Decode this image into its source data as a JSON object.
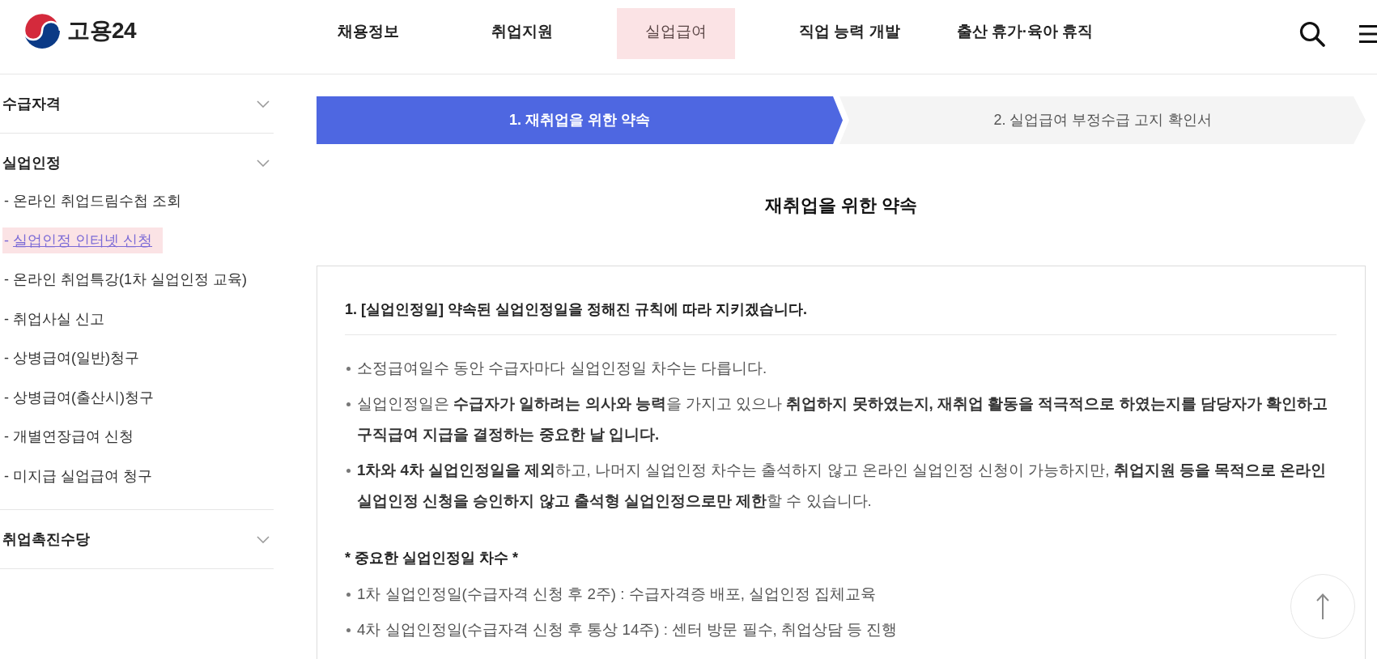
{
  "header": {
    "logo": {
      "text": "고용24"
    },
    "nav": [
      {
        "label": "채용정보",
        "selected": false
      },
      {
        "label": "취업지원",
        "selected": false
      },
      {
        "label": "실업급여",
        "selected": true
      },
      {
        "label": "직업 능력 개발",
        "selected": false
      },
      {
        "label": "출산 휴가·육아 휴직",
        "selected": false
      }
    ]
  },
  "sidebar": {
    "sections": [
      {
        "title": "수급자격"
      },
      {
        "title": "실업인정",
        "items": [
          {
            "bullet": "-",
            "label": "온라인 취업드림수첩 조회",
            "selected": false
          },
          {
            "bullet": "-",
            "label": "실업인정 인터넷 신청",
            "selected": true
          },
          {
            "bullet": "-",
            "label": "온라인 취업특강(1차 실업인정 교육)",
            "selected": false
          },
          {
            "bullet": "-",
            "label": "취업사실 신고",
            "selected": false
          },
          {
            "bullet": "-",
            "label": "상병급여(일반)청구",
            "selected": false
          },
          {
            "bullet": "-",
            "label": "상병급여(출산시)청구",
            "selected": false
          },
          {
            "bullet": "-",
            "label": "개별연장급여 신청",
            "selected": false
          },
          {
            "bullet": "-",
            "label": "미지급 실업급여 청구",
            "selected": false
          }
        ]
      },
      {
        "title": "취업촉진수당"
      }
    ]
  },
  "steps": [
    {
      "label": "1. 재취업을 위한 약속",
      "selected": true
    },
    {
      "label": "2. 실업급여 부정수급 고지 확인서",
      "selected": false
    }
  ],
  "page_title": "재취업을 위한 약속",
  "promise": {
    "blocks": [
      {
        "kind": "titled",
        "heading": "1. [실업인정일] 약속된 실업인정일을 정해진 규칙에 따라 지키겠습니다.",
        "bullets": [
          "소정급여일수 동안 수급자마다 실업인정일 차수는 다릅니다.",
          "실업인정일은 **수급자가 일하려는 의사와 능력**을 가지고 있으나 **취업하지 못하였는지, 재취업 활동을 적극적으로 하였는지를 담당자가 확인하고 구직급여 지급을 결정하는 중요한 날 입니다.**",
          "**1차와 4차 실업인정일을 제외**하고, 나머지 실업인정 차수는 출석하지 않고 온라인 실업인정 신청이 가능하지만, **취업지원 등을 목적으로 온라인 실업인정 신청을 승인하지 않고 출석형 실업인정으로만 제한**할 수 있습니다."
        ]
      },
      {
        "kind": "note",
        "heading": "* 중요한 실업인정일 차수 *",
        "bullets": [
          "1차 실업인정일(수급자격 신청 후 2주) : 수급자격증 배포, 실업인정 집체교육",
          "4차 실업인정일(수급자격 신청 후 통상 14주) : 센터 방문 필수, 취업상담 등 진행"
        ]
      }
    ]
  }
}
